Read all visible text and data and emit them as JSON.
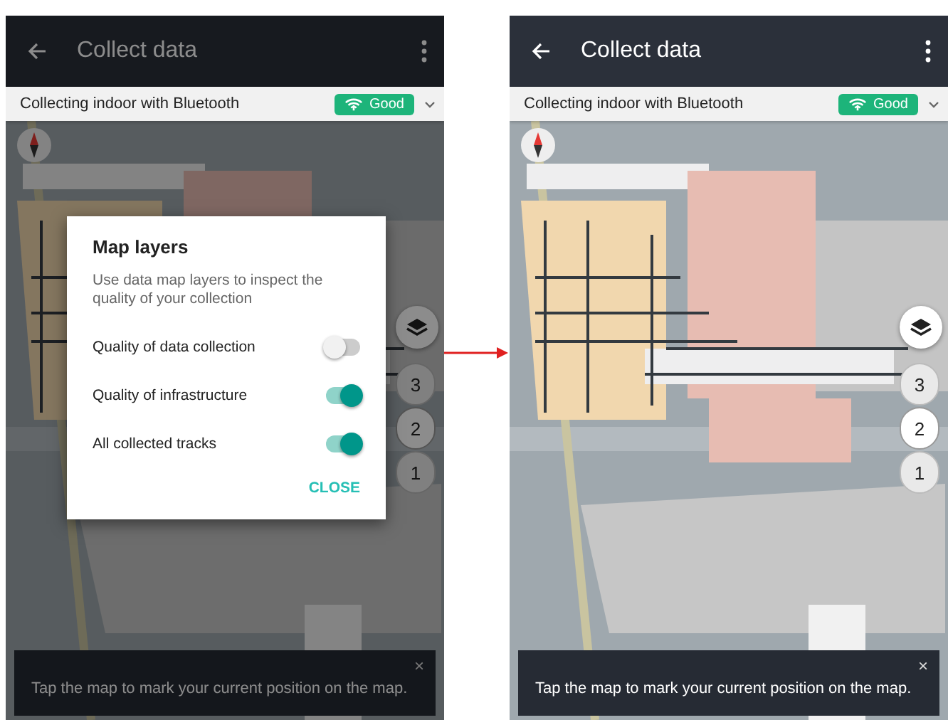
{
  "screens": [
    {
      "title": "Collect data",
      "status": {
        "text": "Collecting indoor with Bluetooth",
        "signal": "Good"
      },
      "floors": [
        {
          "label": "3",
          "selected": false
        },
        {
          "label": "2",
          "selected": true
        },
        {
          "label": "1",
          "selected": false
        }
      ],
      "snackbar": {
        "message": "Tap the map to mark your current position on the map.",
        "close": "×"
      },
      "dialog": {
        "title": "Map layers",
        "description": "Use data map layers to inspect the quality of your collection",
        "layers": [
          {
            "label": "Quality of data collection",
            "on": false
          },
          {
            "label": "Quality of infrastructure",
            "on": true
          },
          {
            "label": "All collected tracks",
            "on": true
          }
        ],
        "action": "CLOSE"
      }
    },
    {
      "title": "Collect data",
      "status": {
        "text": "Collecting indoor with Bluetooth",
        "signal": "Good"
      },
      "floors": [
        {
          "label": "3",
          "selected": false
        },
        {
          "label": "2",
          "selected": true
        },
        {
          "label": "1",
          "selected": false
        }
      ],
      "snackbar": {
        "message": "Tap the map to mark your current position on the map.",
        "close": "×"
      }
    }
  ]
}
